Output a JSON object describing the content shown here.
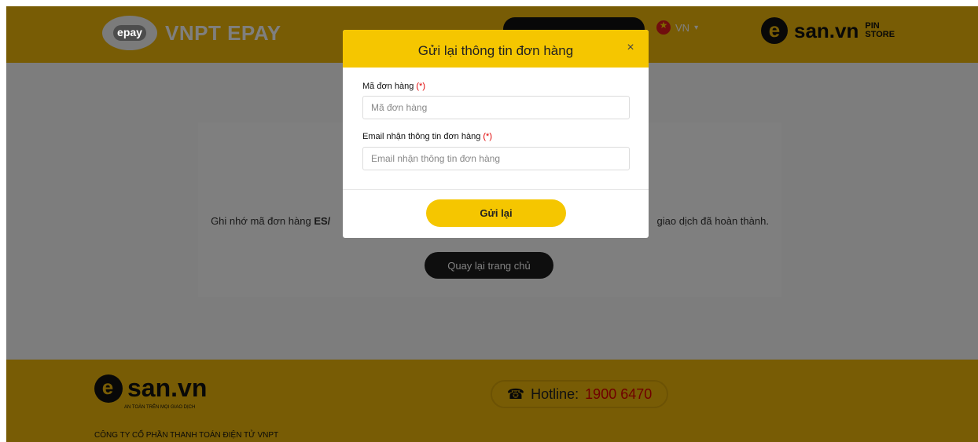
{
  "header": {
    "brand_name": "VNPT EPAY",
    "brand_logo_text": "epay",
    "language": "VN",
    "right_logo_san": "san.vn",
    "right_logo_pin": "PIN",
    "right_logo_store": "STORE"
  },
  "content": {
    "note_prefix": "Ghi nhớ mã đơn hàng ",
    "note_code_partial": "ES/",
    "note_suffix": "giao dịch đã hoàn thành.",
    "home_button": "Quay lại trang chủ"
  },
  "footer": {
    "logo_text": "san.vn",
    "tagline": "AN TOÀN TRÊN MỌI GIAO DỊCH",
    "hotline_label": "Hotline:",
    "hotline_number": "1900 6470",
    "company": "CÔNG TY CỔ PHẦN THANH TOÁN ĐIỆN TỬ VNPT"
  },
  "modal": {
    "title": "Gửi lại thông tin đơn hàng",
    "close_glyph": "×",
    "order_label": "Mã đơn hàng",
    "order_placeholder": "Mã đơn hàng",
    "email_label": "Email nhận thông tin đơn hàng",
    "email_placeholder": "Email nhận thông tin đơn hàng",
    "required_mark": "(*)",
    "submit_button": "Gửi lại"
  },
  "colors": {
    "brand_yellow": "#f0b90b",
    "modal_yellow": "#f5c600",
    "hotline_red": "#e00000"
  }
}
